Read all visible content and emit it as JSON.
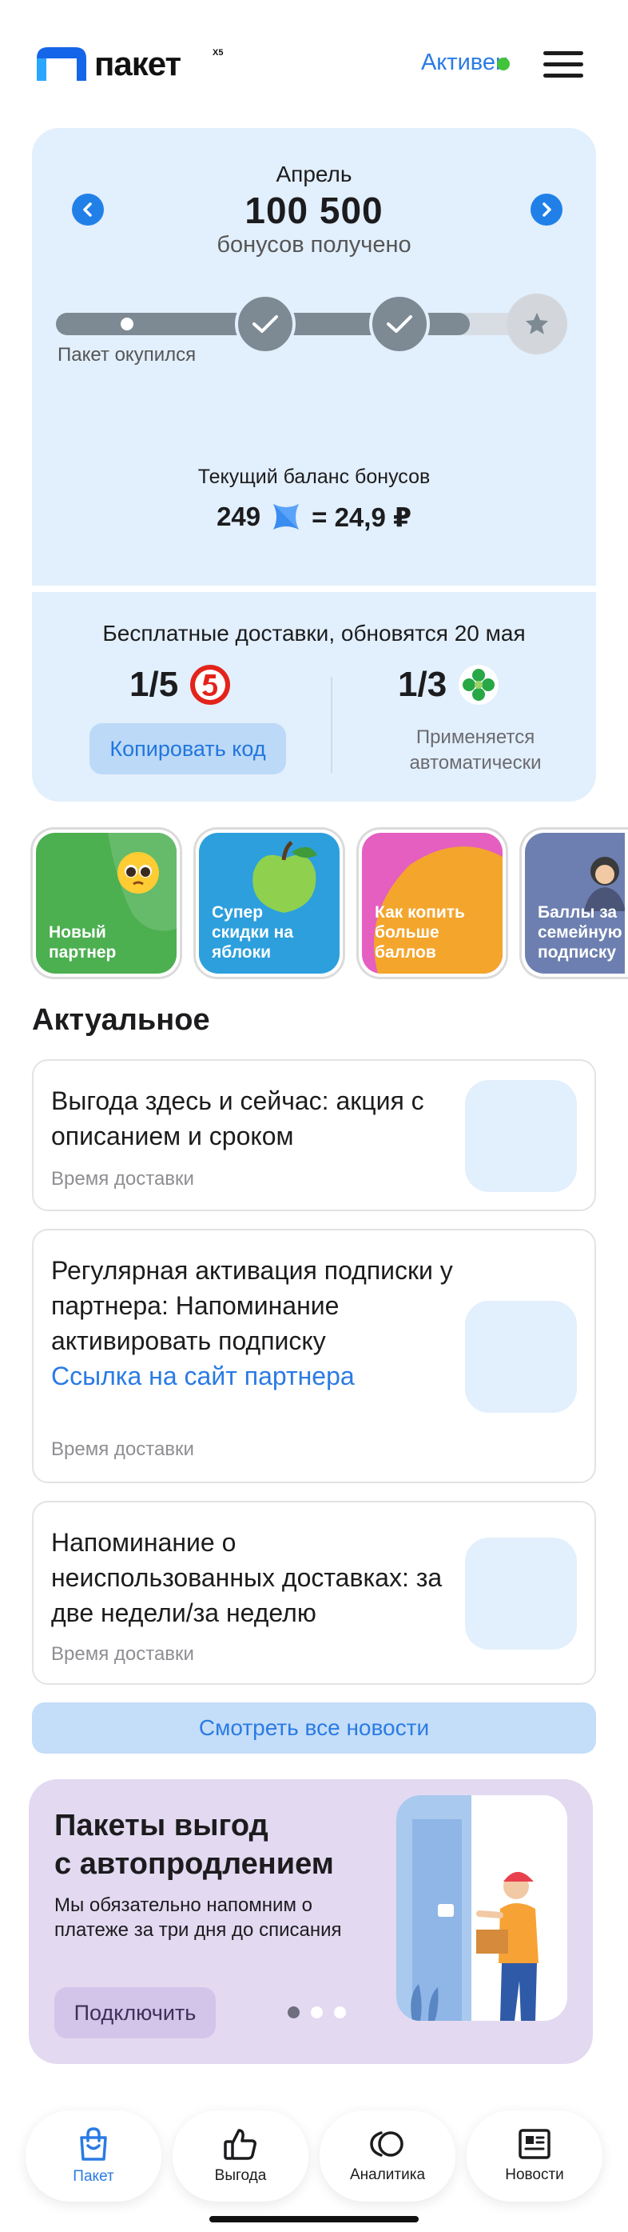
{
  "header": {
    "logo_text": "пакет",
    "logo_badge": "X5",
    "status": "Активен",
    "status_color": "#41c33a"
  },
  "bonus_card": {
    "month": "Апрель",
    "amount": "100 500",
    "amount_caption": "бонусов получено",
    "progress_label": "Пакет окупился",
    "progress_fraction": 0.81,
    "milestones": [
      "done",
      "done",
      "locked"
    ],
    "balance_label": "Текущий баланс бонусов",
    "balance_points": "249",
    "balance_rub": "= 24,9 ₽"
  },
  "deliveries": {
    "title": "Бесплатные доставки, обновятся 20 мая",
    "pyaterochka": {
      "count": "1/5",
      "button": "Копировать код"
    },
    "perekrestok": {
      "count": "1/3",
      "note": "Применяется автоматически"
    }
  },
  "stories": [
    {
      "label": "Новый партнер",
      "color": "#4caf50"
    },
    {
      "label": "Супер скидки на яблоки",
      "color": "#2d9fdd"
    },
    {
      "label": "Как копить больше баллов",
      "color": "#e45fc0"
    },
    {
      "label": "Баллы за семейную подписку",
      "color": "#6d7fb0"
    }
  ],
  "news": {
    "title": "Актуальное",
    "items": [
      {
        "text": "Выгода здесь и сейчас: акция с описанием и сроком",
        "link": "",
        "meta": "Время доставки"
      },
      {
        "text": "Регулярная активация подписки у партнера: Напоминание активировать подписку",
        "link": "Ссылка на сайт партнера",
        "meta": "Время доставки"
      },
      {
        "text": "Напоминание о неиспользованных доставках: за две недели/за неделю",
        "link": "",
        "meta": "Время доставки"
      }
    ],
    "all_button": "Смотреть все новости"
  },
  "promo": {
    "title_line1": "Пакеты выгод",
    "title_line2": "с автопродлением",
    "description": "Мы обязательно напомним о платеже за три дня до списания",
    "button": "Подключить",
    "slides": 3,
    "active_slide": 1
  },
  "tabs": [
    {
      "label": "Пакет",
      "icon": "bag-icon",
      "active": true
    },
    {
      "label": "Выгода",
      "icon": "thumbs-up-icon",
      "active": false
    },
    {
      "label": "Аналитика",
      "icon": "analytics-icon",
      "active": false
    },
    {
      "label": "Новости",
      "icon": "newspaper-icon",
      "active": false
    }
  ],
  "colors": {
    "accent": "#2a7be4",
    "card_bg": "#e2effc",
    "promo_bg": "#e3d9f1"
  }
}
